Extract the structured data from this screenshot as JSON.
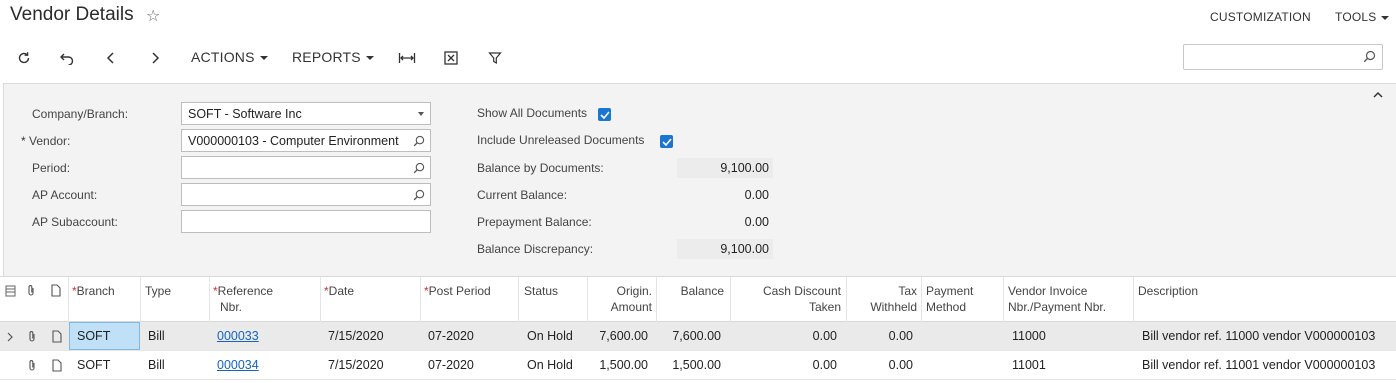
{
  "header": {
    "title": "Vendor Details",
    "customization": "CUSTOMIZATION",
    "tools": "TOOLS"
  },
  "toolbar": {
    "actions": "ACTIONS",
    "reports": "REPORTS"
  },
  "search": {
    "placeholder": ""
  },
  "form": {
    "company_label": "Company/Branch:",
    "company_value": "SOFT - Software Inc",
    "vendor_label": "Vendor:",
    "vendor_value": "V000000103 - Computer Environment",
    "period_label": "Period:",
    "period_value": "",
    "ap_account_label": "AP Account:",
    "ap_account_value": "",
    "ap_sub_label": "AP Subaccount:",
    "ap_sub_value": "",
    "show_all_label": "Show All Documents",
    "include_unreleased_label": "Include Unreleased Documents",
    "balance_docs_label": "Balance by Documents:",
    "balance_docs_value": "9,100.00",
    "current_balance_label": "Current Balance:",
    "current_balance_value": "0.00",
    "prepayment_label": "Prepayment Balance:",
    "prepayment_value": "0.00",
    "discrepancy_label": "Balance Discrepancy:",
    "discrepancy_value": "9,100.00"
  },
  "grid": {
    "headers": {
      "branch": "Branch",
      "type": "Type",
      "ref_1": "Reference",
      "ref_2": "Nbr.",
      "date": "Date",
      "post_period": "Post Period",
      "status": "Status",
      "orig_1": "Origin.",
      "orig_2": "Amount",
      "balance": "Balance",
      "cash_1": "Cash Discount",
      "cash_2": "Taken",
      "tax_1": "Tax",
      "tax_2": "Withheld",
      "pay_1": "Payment",
      "pay_2": "Method",
      "vinv_1": "Vendor Invoice",
      "vinv_2": "Nbr./Payment Nbr.",
      "description": "Description"
    },
    "rows": [
      {
        "branch": "SOFT",
        "type": "Bill",
        "ref": "000033",
        "date": "7/15/2020",
        "period": "07-2020",
        "status": "On Hold",
        "orig": "7,600.00",
        "balance": "7,600.00",
        "cash": "0.00",
        "tax": "0.00",
        "payment": "",
        "vinv": "11000",
        "desc": "Bill vendor ref. 11000 vendor V000000103"
      },
      {
        "branch": "SOFT",
        "type": "Bill",
        "ref": "000034",
        "date": "7/15/2020",
        "period": "07-2020",
        "status": "On Hold",
        "orig": "1,500.00",
        "balance": "1,500.00",
        "cash": "0.00",
        "tax": "0.00",
        "payment": "",
        "vinv": "11001",
        "desc": "Bill vendor ref. 11001 vendor V000000103"
      }
    ]
  }
}
